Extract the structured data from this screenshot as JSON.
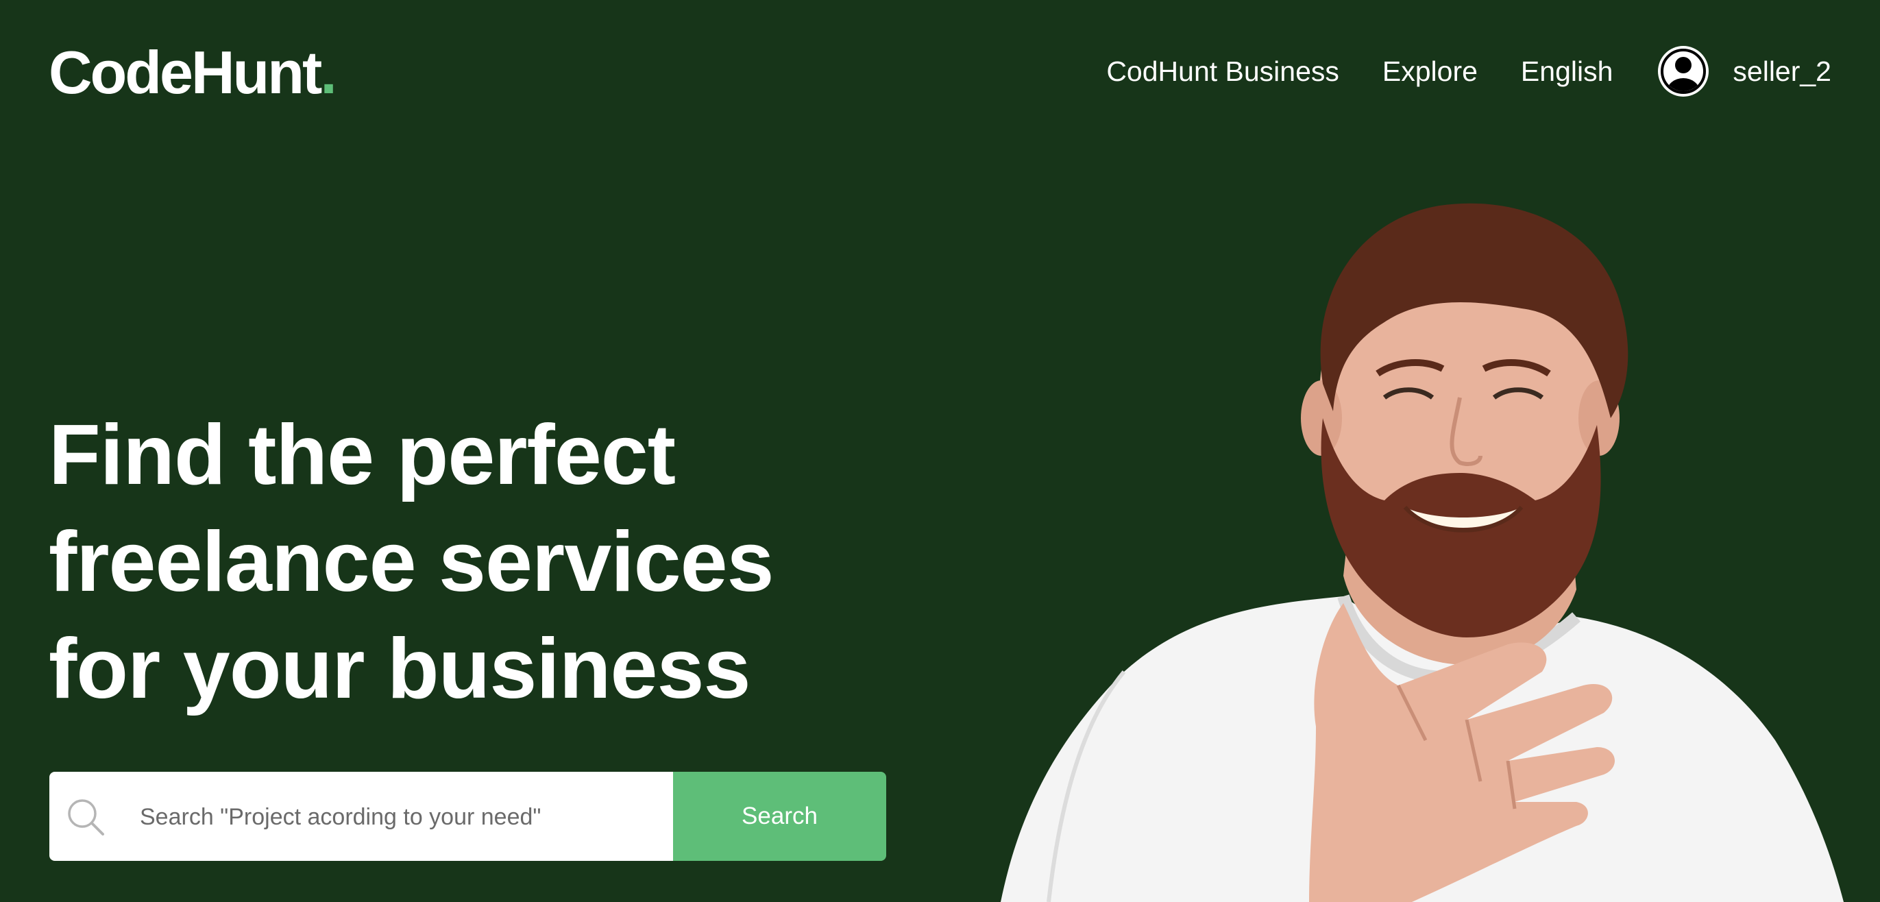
{
  "brand": {
    "name": "CodeHunt",
    "dot": "."
  },
  "nav": {
    "business_label": "CodHunt Business",
    "explore_label": "Explore",
    "language_label": "English",
    "user": {
      "username": "seller_2",
      "icon": "user-avatar-icon"
    }
  },
  "hero": {
    "headline_lines": [
      "Find the perfect",
      "freelance services",
      "for your business"
    ],
    "search": {
      "placeholder": "Search \"Project acording to your need\"",
      "value": "",
      "button_label": "Search",
      "icon": "search-icon"
    },
    "image": "smiling-bearded-man-photo"
  },
  "colors": {
    "background": "#173519",
    "accent": "#5ebe78",
    "text": "#ffffff"
  }
}
